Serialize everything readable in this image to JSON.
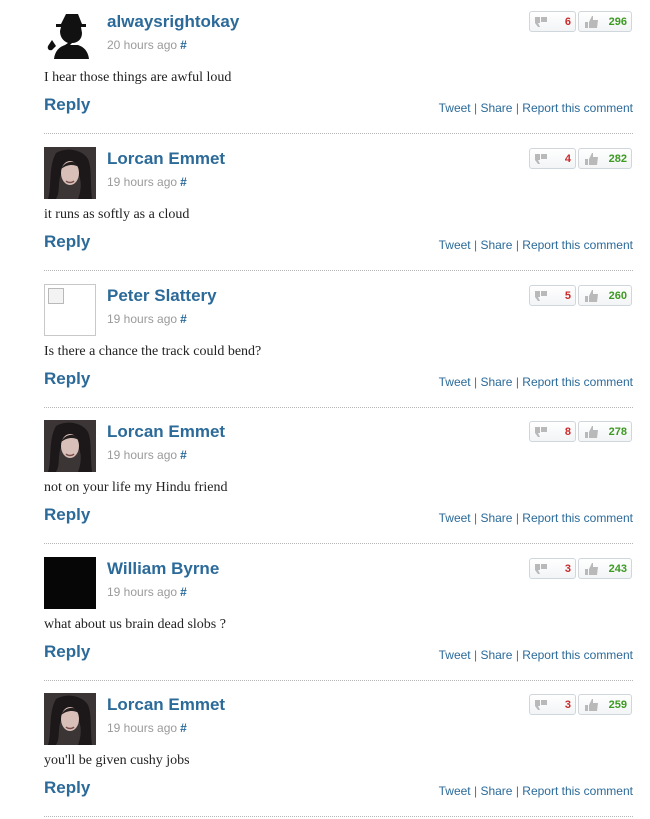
{
  "comments": [
    {
      "author": "alwaysrightokay",
      "time": "20 hours ago",
      "hash": "#",
      "text": "I hear those things are awful loud",
      "down": "6",
      "up": "296",
      "avatar": "silhouette-icon"
    },
    {
      "author": "Lorcan Emmet",
      "time": "19 hours ago",
      "hash": "#",
      "text": "it runs as softly as a cloud",
      "down": "4",
      "up": "282",
      "avatar": "photo"
    },
    {
      "author": "Peter Slattery",
      "time": "19 hours ago",
      "hash": "#",
      "text": "Is there a chance the track could bend?",
      "down": "5",
      "up": "260",
      "avatar": "broken-image-icon"
    },
    {
      "author": "Lorcan Emmet",
      "time": "19 hours ago",
      "hash": "#",
      "text": "not on your life my Hindu friend",
      "down": "8",
      "up": "278",
      "avatar": "photo"
    },
    {
      "author": "William Byrne",
      "time": "19 hours ago",
      "hash": "#",
      "text": "what about us brain dead slobs ?",
      "down": "3",
      "up": "243",
      "avatar": "black"
    },
    {
      "author": "Lorcan Emmet",
      "time": "19 hours ago",
      "hash": "#",
      "text": "you'll be given cushy jobs",
      "down": "3",
      "up": "259",
      "avatar": "photo"
    }
  ],
  "labels": {
    "reply": "Reply",
    "tweet": "Tweet",
    "share": "Share",
    "report": "Report this comment",
    "separator": "|"
  },
  "colors": {
    "link": "#2b6a99",
    "downvote": "#cc2a2a",
    "upvote": "#3d9a22"
  }
}
